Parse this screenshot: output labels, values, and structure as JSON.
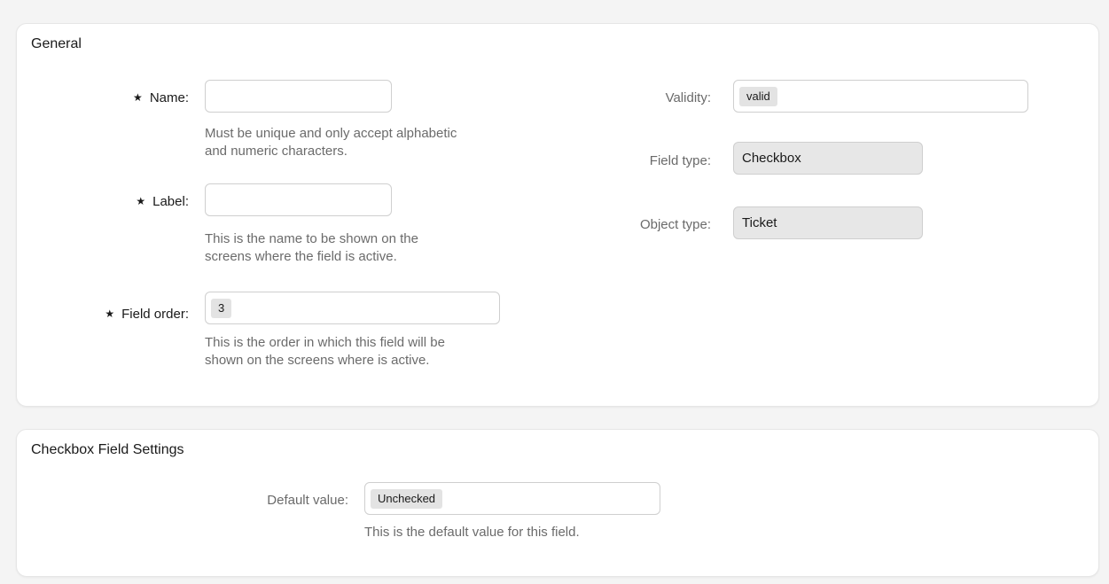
{
  "general": {
    "title": "General",
    "name": {
      "label": "Name:",
      "value": "",
      "help": "Must be unique and only accept alphabetic\nand numeric characters."
    },
    "label": {
      "label": "Label:",
      "value": "",
      "help": "This is the name to be shown on the\nscreens where the field is active."
    },
    "field_order": {
      "label": "Field order:",
      "value": "3",
      "help": "This is the order in which this field will be\nshown on the screens where is active."
    },
    "validity": {
      "label": "Validity:",
      "value": "valid"
    },
    "field_type": {
      "label": "Field type:",
      "value": "Checkbox"
    },
    "object_type": {
      "label": "Object type:",
      "value": "Ticket"
    },
    "required_marker": "★"
  },
  "checkbox_settings": {
    "title": "Checkbox Field Settings",
    "default_value": {
      "label": "Default value:",
      "value": "Unchecked",
      "help": "This is the default value for this field."
    }
  }
}
